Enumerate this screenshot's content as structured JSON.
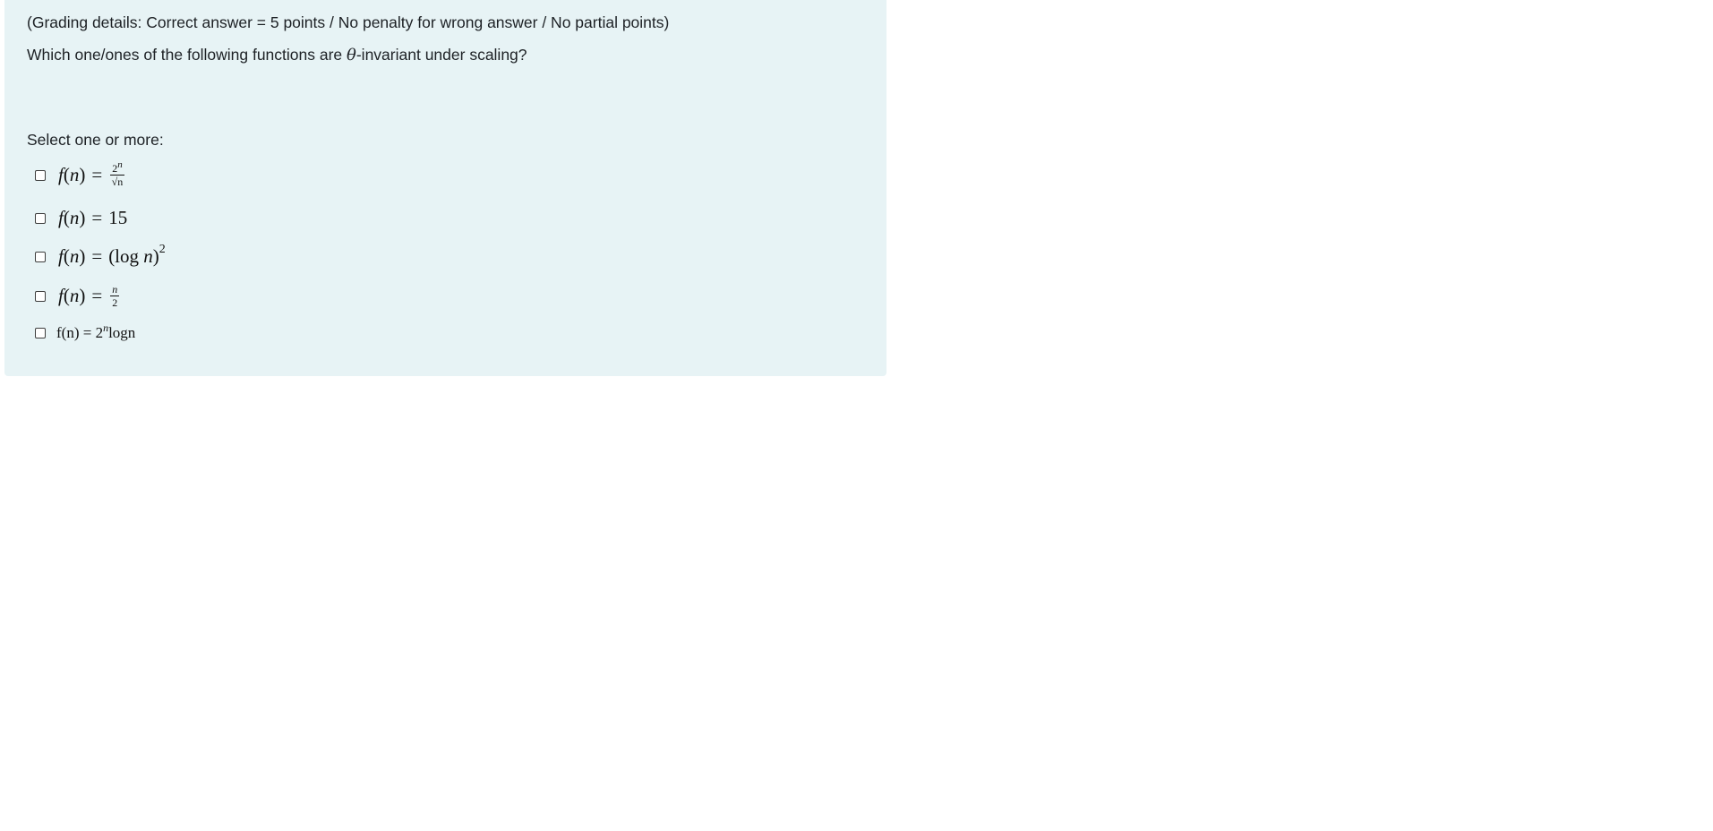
{
  "question": {
    "grading_details": "(Grading details: Correct answer = 5 points / No penalty for wrong answer / No partial points)",
    "text_before": "Which one/ones of the following functions are ",
    "symbol": "θ",
    "text_after": "-invariant under scaling?",
    "prompt": "Select one or more:"
  },
  "options": [
    {
      "f": "f",
      "n": "n",
      "eq": "=",
      "num_base": "2",
      "num_exp": "n",
      "den": "√n"
    },
    {
      "f": "f",
      "n": "n",
      "eq": "=",
      "value": "15"
    },
    {
      "f": "f",
      "n": "n",
      "eq": "=",
      "open": "(log ",
      "var": "n",
      "close": ")",
      "exp": "2"
    },
    {
      "f": "f",
      "n": "n",
      "eq": "=",
      "num": "n",
      "den": "2"
    },
    {
      "text_f": "f(n) = 2",
      "exp": "n",
      "rest": "logn"
    }
  ],
  "colors": {
    "panel_background": "#e7f3f5",
    "text": "#1d2125"
  },
  "icons": [
    "checkbox-icon"
  ]
}
